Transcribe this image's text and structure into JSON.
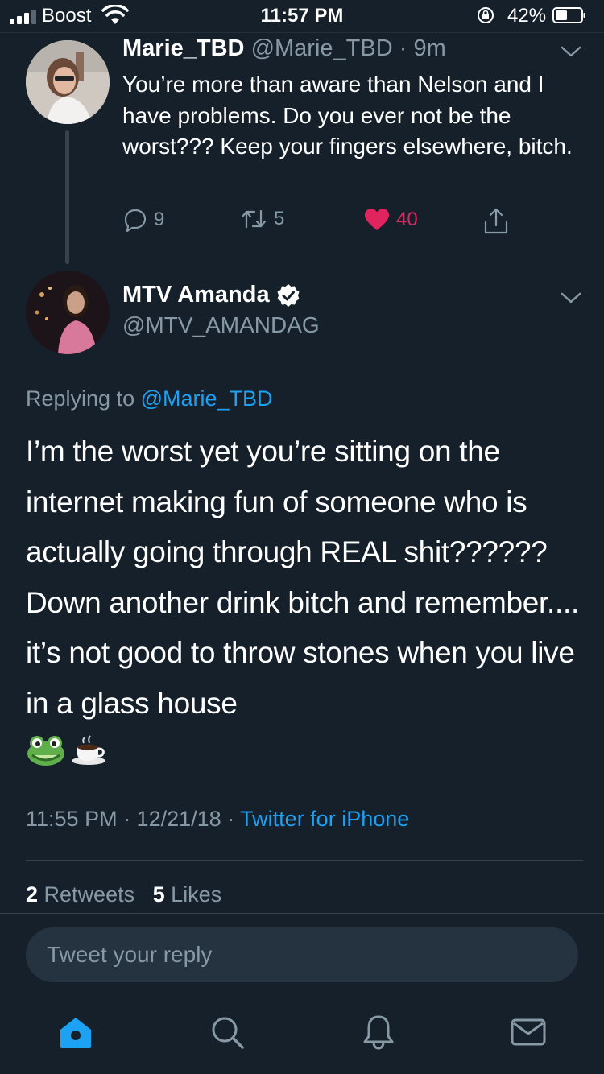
{
  "status_bar": {
    "carrier": "Boost",
    "time": "11:57 PM",
    "battery": "42%",
    "icons": [
      "signal-icon",
      "wifi-icon",
      "orientation-lock-icon",
      "battery-icon"
    ]
  },
  "parent_tweet": {
    "name": "Marie_TBD",
    "handle": "@Marie_TBD",
    "age": "9m",
    "text": "You’re more than aware than Nelson and I have problems. Do you ever not be the worst??? Keep your fingers elsewhere, bitch.",
    "replies": "9",
    "retweets": "5",
    "likes": "40"
  },
  "main_tweet": {
    "name": "MTV Amanda",
    "handle": "@MTV_AMANDAG",
    "replying_prefix": "Replying to",
    "replying_to": "@Marie_TBD",
    "text": "I’m the worst yet you’re sitting on the internet making fun of someone who is actually going through REAL shit?????? Down another drink bitch and remember.... it’s not good to throw stones when you live in a glass house",
    "emojis": [
      "🐸",
      "☕"
    ],
    "timestamp": "11:55 PM · 12/21/18 · ",
    "source": "Twitter for iPhone",
    "retweet_count": "2",
    "retweet_label": "Retweets",
    "like_count": "5",
    "like_label": "Likes"
  },
  "reply_bar": {
    "placeholder": "Tweet your reply"
  },
  "tab_bar": {
    "tabs": [
      "home-icon",
      "search-icon",
      "notifications-icon",
      "messages-icon"
    ],
    "active": "home-icon"
  },
  "colors": {
    "background": "#15202b",
    "accent": "#1da1f2",
    "like": "#e0245e",
    "secondary_text": "#8899a6"
  }
}
